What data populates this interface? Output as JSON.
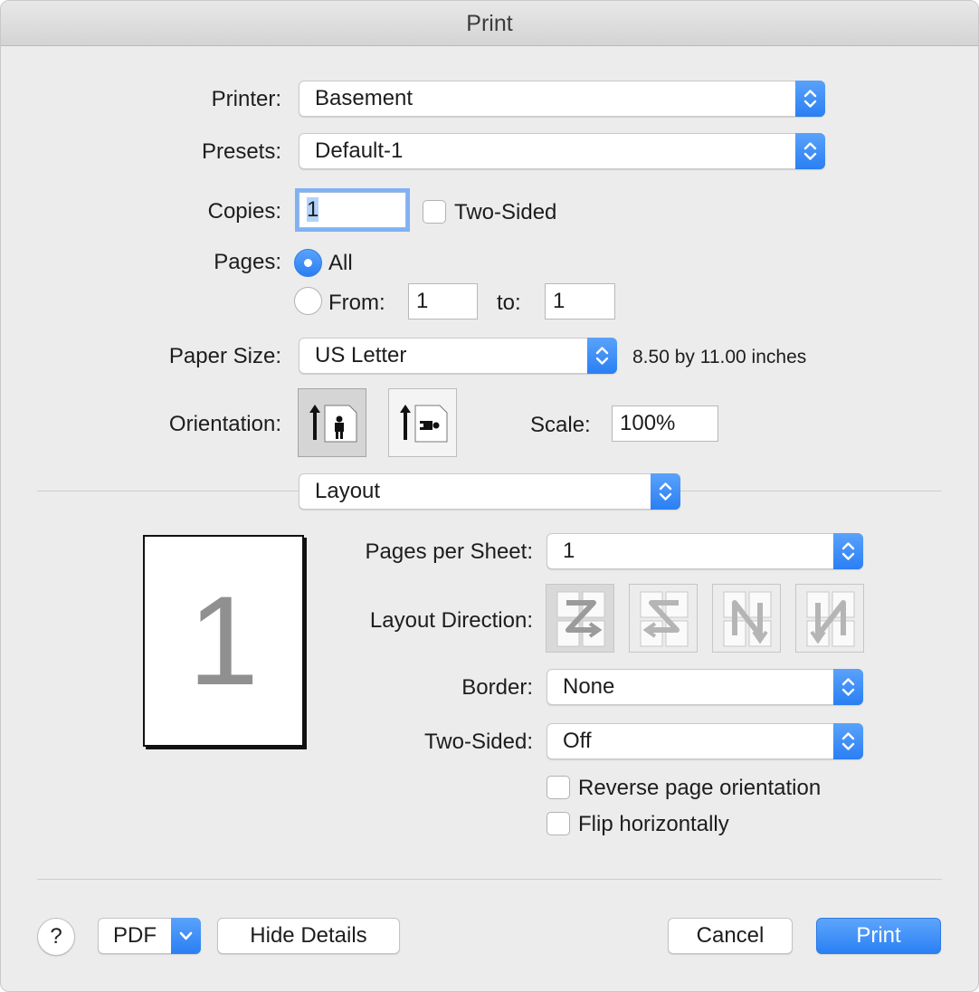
{
  "window": {
    "title": "Print"
  },
  "printer": {
    "label": "Printer:",
    "value": "Basement"
  },
  "presets": {
    "label": "Presets:",
    "value": "Default-1"
  },
  "copies": {
    "label": "Copies:",
    "value": "1",
    "two_sided_label": "Two-Sided"
  },
  "pages": {
    "label": "Pages:",
    "all_label": "All",
    "from_label": "From:",
    "from_value": "1",
    "to_label": "to:",
    "to_value": "1"
  },
  "paper_size": {
    "label": "Paper Size:",
    "value": "US Letter",
    "dimensions": "8.50 by 11.00 inches"
  },
  "orientation": {
    "label": "Orientation:",
    "selected": "portrait"
  },
  "scale": {
    "label": "Scale:",
    "value": "100%"
  },
  "section": {
    "value": "Layout"
  },
  "preview": {
    "page_number": "1"
  },
  "layout": {
    "pages_per_sheet_label": "Pages per Sheet:",
    "pages_per_sheet_value": "1",
    "layout_direction_label": "Layout Direction:",
    "border_label": "Border:",
    "border_value": "None",
    "two_sided_label": "Two-Sided:",
    "two_sided_value": "Off",
    "reverse_label": "Reverse page orientation",
    "flip_label": "Flip horizontally"
  },
  "footer": {
    "help_label": "?",
    "pdf_label": "PDF",
    "hide_details_label": "Hide Details",
    "cancel_label": "Cancel",
    "print_label": "Print"
  },
  "colors": {
    "accent": "#2a80f4",
    "background": "#ececec"
  }
}
